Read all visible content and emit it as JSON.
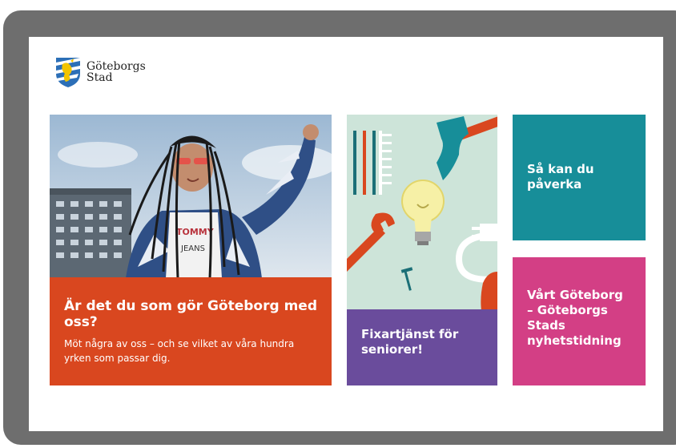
{
  "logo": {
    "line1": "Göteborgs",
    "line2": "Stad",
    "crest_icon": "goteborg-crest-icon"
  },
  "cards": {
    "hero": {
      "title": "Är det du som gör Göteborg med oss?",
      "text": "Möt några av oss – och se vilket av våra hundra yrken som passar dig.",
      "color": "#d9471f"
    },
    "fixartjanst": {
      "title": "Fixartjänst för seniorer!",
      "color": "#6a4c9c",
      "illustration_bg": "#cde4d9"
    },
    "paverka": {
      "title": "Så kan du påverka",
      "color": "#178e99"
    },
    "nyhetstidning": {
      "title": "Vårt Göteborg – Göteborgs Stads nyhetstidning",
      "color": "#d33f85"
    }
  },
  "colors": {
    "frame": "#6e6e6e",
    "screen": "#ffffff"
  }
}
